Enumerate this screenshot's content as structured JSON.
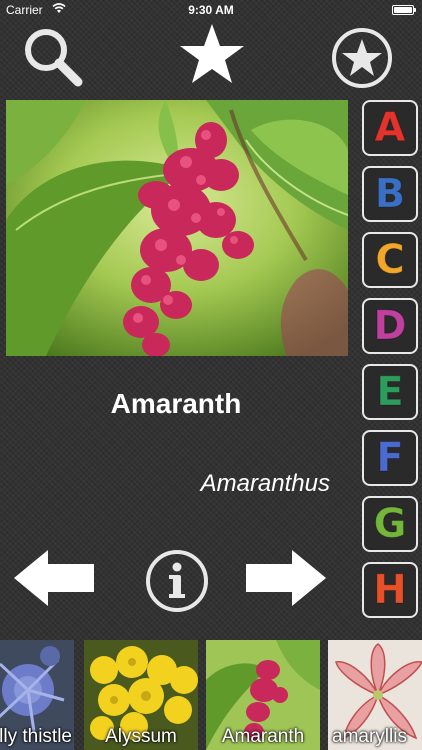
{
  "status_bar": {
    "carrier": "Carrier",
    "time": "9:30 AM",
    "battery_level": 1.0
  },
  "toolbar": {
    "search_icon": "search-icon",
    "star_icon": "star-icon",
    "favorites_icon": "star-circle-icon"
  },
  "plant": {
    "name": "Amaranth",
    "latin": "Amaranthus"
  },
  "navigation": {
    "prev_icon": "arrow-left-icon",
    "info_icon": "info-icon",
    "next_icon": "arrow-right-icon"
  },
  "alphabet": [
    {
      "letter": "A",
      "color": "#e2342c"
    },
    {
      "letter": "B",
      "color": "#3a6fc4"
    },
    {
      "letter": "C",
      "color": "#f2a72a"
    },
    {
      "letter": "D",
      "color": "#c040a0"
    },
    {
      "letter": "E",
      "color": "#2e9c5c"
    },
    {
      "letter": "F",
      "color": "#4a6ad0"
    },
    {
      "letter": "G",
      "color": "#74b63a"
    },
    {
      "letter": "H",
      "color": "#e8502a"
    }
  ],
  "thumbnails": [
    {
      "label": "sea holly thistle"
    },
    {
      "label": "Alyssum"
    },
    {
      "label": "Amaranth"
    },
    {
      "label": "amaryllis"
    }
  ]
}
